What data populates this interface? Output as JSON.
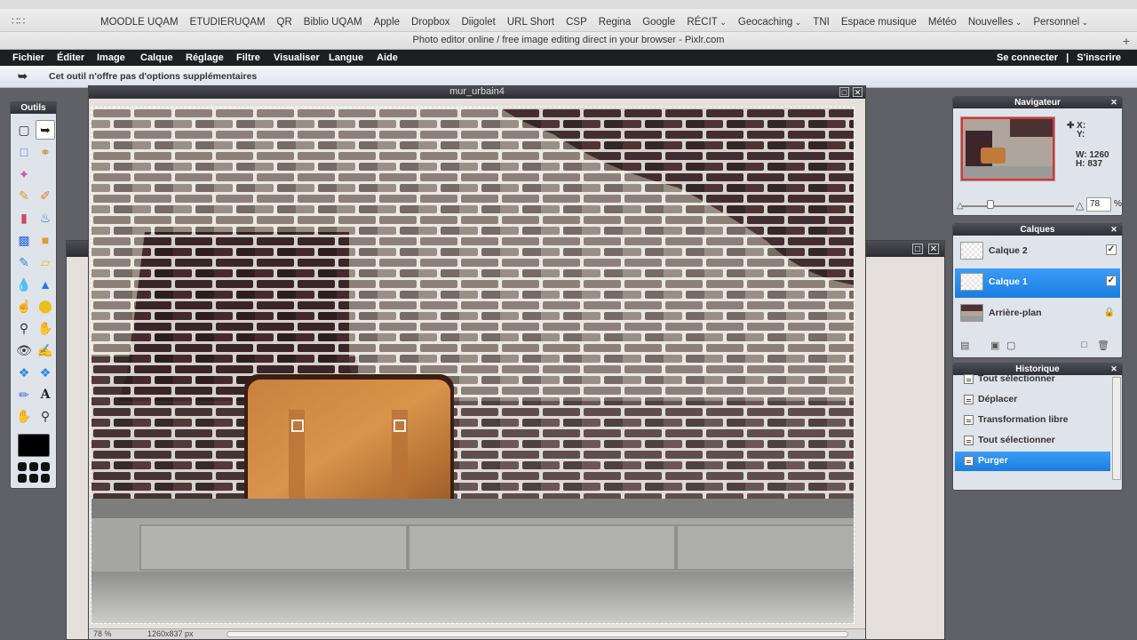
{
  "browser": {
    "bookmarks": [
      "MOODLE UQAM",
      "ETUDIERUQAM",
      "QR",
      "Biblio UQAM",
      "Apple",
      "Dropbox",
      "Diigolet",
      "URL Short",
      "CSP",
      "Regina",
      "Google",
      "RÉCIT",
      "Geocaching",
      "TNI",
      "Espace musique",
      "Météo",
      "Nouvelles",
      "Personnel"
    ],
    "page_title": "Photo editor online / free image editing direct in your browser - Pixlr.com"
  },
  "menu": {
    "items": [
      "Fichier",
      "Éditer",
      "Image",
      "Calque",
      "Réglage",
      "Filtre",
      "Visualiser",
      "Langue",
      "Aide"
    ],
    "login": "Se connecter",
    "signup": "S'inscrire"
  },
  "options_bar": {
    "text": "Cet outil n'offre pas d'options supplémentaires"
  },
  "tools": {
    "title": "Outils",
    "icons": [
      "crop-icon",
      "move-icon",
      "marquee-icon",
      "lasso-icon",
      "wand-icon",
      "blank",
      "pencil-icon",
      "brush-icon",
      "eraser-icon",
      "spray-icon",
      "gradient-icon",
      "stamp-icon",
      "colour-replace-icon",
      "fill-icon",
      "drop-icon",
      "sharpen-icon",
      "smudge-icon",
      "sponge-icon",
      "dodge-icon",
      "burn-icon",
      "redeye-icon",
      "spot-heal-icon",
      "bloat-icon",
      "pinch-icon",
      "colour-picker-icon",
      "text-icon",
      "hand-icon",
      "zoom-icon"
    ],
    "foreground_color": "#000000"
  },
  "document": {
    "title": "mur_urbain4",
    "zoom": "78",
    "zoom_unit": "%",
    "size": "1260x837 px"
  },
  "navigator": {
    "title": "Navigateur",
    "x_label": "X:",
    "y_label": "Y:",
    "w_label": "W: 1260",
    "h_label": "H:  837",
    "zoom": "78",
    "zoom_unit": "%"
  },
  "layers": {
    "title": "Calques",
    "items": [
      {
        "name": "Calque 2",
        "selected": false
      },
      {
        "name": "Calque 1",
        "selected": true
      },
      {
        "name": "Arrière-plan",
        "selected": false
      }
    ]
  },
  "history": {
    "title": "Historique",
    "items": [
      "Tout sélectionner",
      "Déplacer",
      "Transformation libre",
      "Tout sélectionner",
      "Purger"
    ]
  },
  "colors": {
    "menubar": "#1e1f23",
    "selection": "#1a7ee0",
    "workspace": "#5f6166"
  }
}
